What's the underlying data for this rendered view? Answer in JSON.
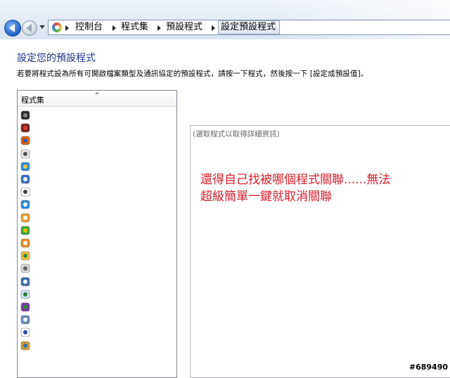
{
  "address_bar": {
    "breadcrumbs": [
      "控制台",
      "程式集",
      "預設程式",
      "設定預設程式"
    ],
    "location_icon": "control-panel-icon"
  },
  "nav_icons": {
    "back": "back-arrow-icon",
    "forward": "forward-arrow-icon",
    "history": "chevron-down-icon"
  },
  "page": {
    "title": "設定您的預設程式",
    "description": "若要將程式設為所有可開啟檔案類型及通訊協定的預設程式，請按一下程式，然後按一下 [設定成預設值]。"
  },
  "program_list": {
    "header": "程式集",
    "items": [
      {
        "icon": "media-center-icon",
        "color": "#2b2b2b",
        "accent": "#888888"
      },
      {
        "icon": "game-icon",
        "color": "#7a1f1f",
        "accent": "#d04040"
      },
      {
        "icon": "firefox-icon",
        "color": "#e66000",
        "accent": "#2f5bb7"
      },
      {
        "icon": "alien-icon",
        "color": "#e8e8e8",
        "accent": "#555555"
      },
      {
        "icon": "internet-explorer-icon",
        "color": "#2f8fe0",
        "accent": "#f4c430"
      },
      {
        "icon": "music-player-icon",
        "color": "#3a6fc8",
        "accent": "#ffffff"
      },
      {
        "icon": "calendar-icon",
        "color": "#ffffff",
        "accent": "#444444"
      },
      {
        "icon": "search-app-icon",
        "color": "#2a8be0",
        "accent": "#ffffff"
      },
      {
        "icon": "photo-gallery-icon",
        "color": "#f0a030",
        "accent": "#ffffff"
      },
      {
        "icon": "media-player-icon",
        "color": "#3aa83a",
        "accent": "#f0c000"
      },
      {
        "icon": "video-player-icon",
        "color": "#f09020",
        "accent": "#ffffff"
      },
      {
        "icon": "folder-icon",
        "color": "#e8c040",
        "accent": "#3a8a3a"
      },
      {
        "icon": "contacts-icon",
        "color": "#d8d8d8",
        "accent": "#666666"
      },
      {
        "icon": "image-viewer-icon",
        "color": "#3a6aa8",
        "accent": "#ffffff"
      },
      {
        "icon": "card-icon",
        "color": "#cfe3f5",
        "accent": "#3a7a3a"
      },
      {
        "icon": "archive-icon",
        "color": "#7a3aa8",
        "accent": "#2a8a2a"
      },
      {
        "icon": "document-icon",
        "color": "#6a8ab8",
        "accent": "#ffffff"
      },
      {
        "icon": "player-icon",
        "color": "#ffffff",
        "accent": "#2a4aa8"
      },
      {
        "icon": "gear-paint-icon",
        "color": "#c8a030",
        "accent": "#3a6ab8"
      }
    ]
  },
  "details": {
    "placeholder": "(選取程式以取得詳細資訊)"
  },
  "annotation": {
    "line1": "還得自己找被哪個程式關聯......無法",
    "line2": "超級簡單一鍵就取消關聯",
    "color": "#d8202a"
  },
  "watermark": "#689490"
}
